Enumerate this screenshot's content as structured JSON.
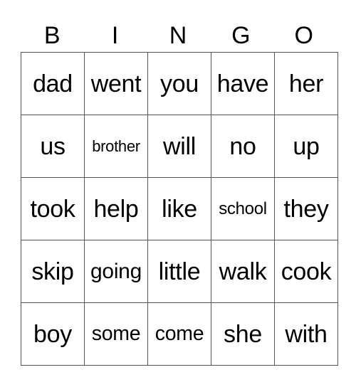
{
  "header": [
    "B",
    "I",
    "N",
    "G",
    "O"
  ],
  "rows": [
    [
      "dad",
      "went",
      "you",
      "have",
      "her"
    ],
    [
      "us",
      "brother",
      "will",
      "no",
      "up"
    ],
    [
      "took",
      "help",
      "like",
      "school",
      "they"
    ],
    [
      "skip",
      "going",
      "little",
      "walk",
      "cook"
    ],
    [
      "boy",
      "some",
      "come",
      "she",
      "with"
    ]
  ]
}
